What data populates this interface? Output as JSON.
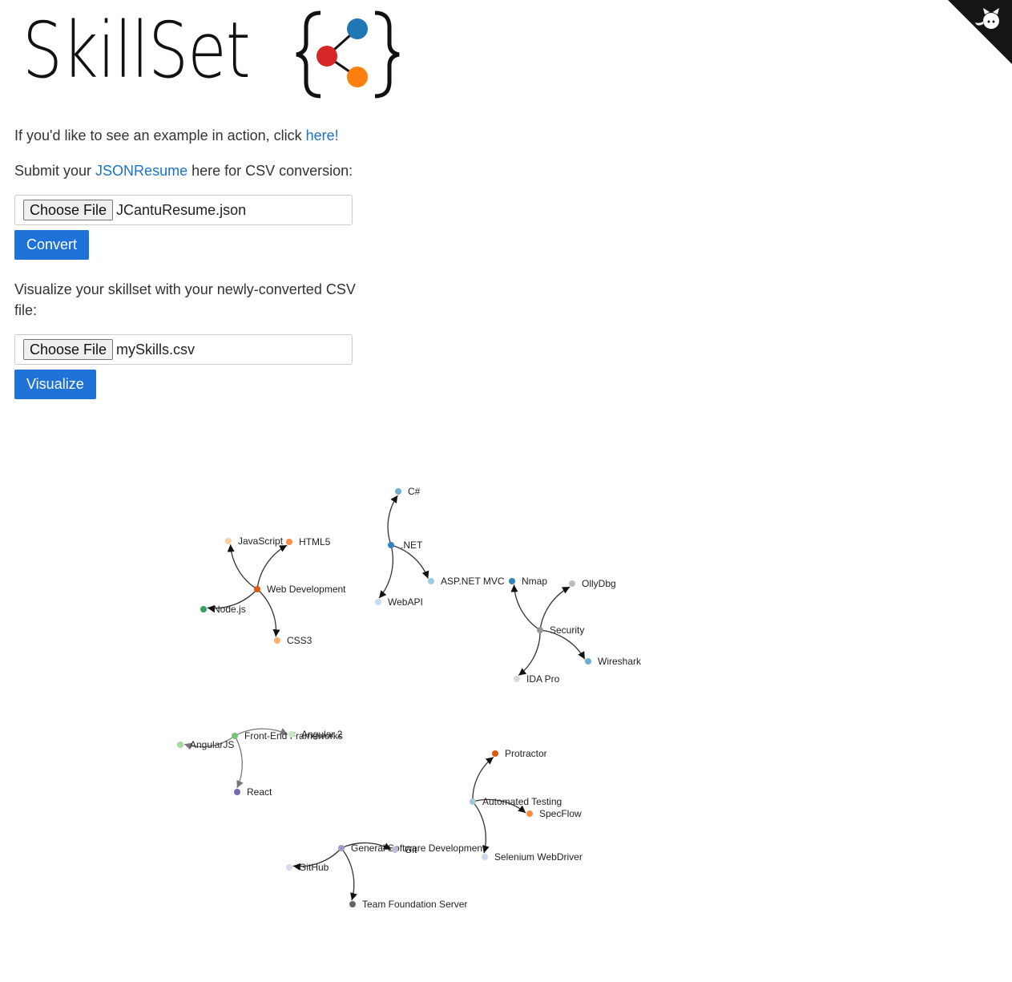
{
  "logo": {
    "text": "SkillSet",
    "dot_colors": [
      "#1f77b4",
      "#d62728",
      "#ff7f0e"
    ]
  },
  "intro": {
    "prefix": "If you'd like to see an example in action, click ",
    "link": "here!"
  },
  "submit": {
    "prefix": "Submit your ",
    "link": "JSONResume",
    "suffix": " here for CSV conversion:"
  },
  "resume_input": {
    "button_label": "Choose File",
    "file_name": "JCantuResume.json"
  },
  "convert_button": "Convert",
  "visualize_text": "Visualize your skillset with your newly-converted CSV file:",
  "csv_input": {
    "button_label": "Choose File",
    "file_name": "mySkills.csv"
  },
  "visualize_button": "Visualize",
  "graph": {
    "nodes": [
      {
        "id": "webdev",
        "label": "Web Development",
        "color": "#e6550d"
      },
      {
        "id": "js",
        "label": "JavaScript",
        "color": "#fdd0a2"
      },
      {
        "id": "html5",
        "label": "HTML5",
        "color": "#fd8d3c"
      },
      {
        "id": "node",
        "label": "Node.js",
        "color": "#31a354"
      },
      {
        "id": "css3",
        "label": "CSS3",
        "color": "#fdae6b"
      },
      {
        "id": "net",
        "label": ".NET",
        "color": "#3182bd"
      },
      {
        "id": "csharp",
        "label": "C#",
        "color": "#6baed6"
      },
      {
        "id": "aspnet",
        "label": "ASP.NET MVC",
        "color": "#9ecae1"
      },
      {
        "id": "webapi",
        "label": "WebAPI",
        "color": "#c6dbef"
      },
      {
        "id": "security",
        "label": "Security",
        "color": "#969696"
      },
      {
        "id": "nmap",
        "label": "Nmap",
        "color": "#3182bd"
      },
      {
        "id": "ollydbg",
        "label": "OllyDbg",
        "color": "#bdbdbd"
      },
      {
        "id": "wireshark",
        "label": "Wireshark",
        "color": "#6baed6"
      },
      {
        "id": "idapro",
        "label": "IDA Pro",
        "color": "#d9d9d9"
      },
      {
        "id": "frontend",
        "label": "Front-End Frameworks",
        "color": "#74c476"
      },
      {
        "id": "angularjs",
        "label": "AngularJS",
        "color": "#a1d99b"
      },
      {
        "id": "angular2",
        "label": "Angular 2",
        "color": "#c7e9c0"
      },
      {
        "id": "react",
        "label": "React",
        "color": "#756bb1"
      },
      {
        "id": "autotest",
        "label": "Automated Testing",
        "color": "#9ecae1"
      },
      {
        "id": "protractor",
        "label": "Protractor",
        "color": "#e6550d"
      },
      {
        "id": "specflow",
        "label": "SpecFlow",
        "color": "#fd8d3c"
      },
      {
        "id": "selenium",
        "label": "Selenium WebDriver",
        "color": "#c6dbef"
      },
      {
        "id": "gensw",
        "label": "General Software Development",
        "color": "#9e9ac8"
      },
      {
        "id": "git",
        "label": "Git",
        "color": "#bcbddc"
      },
      {
        "id": "github",
        "label": "GitHub",
        "color": "#dadaeb"
      },
      {
        "id": "tfs",
        "label": "Team Foundation Server",
        "color": "#636363"
      }
    ],
    "links": [
      {
        "source": "webdev",
        "target": "js",
        "color": "#333333"
      },
      {
        "source": "webdev",
        "target": "html5",
        "color": "#333333"
      },
      {
        "source": "webdev",
        "target": "node",
        "color": "#333333"
      },
      {
        "source": "webdev",
        "target": "css3",
        "color": "#333333"
      },
      {
        "source": "net",
        "target": "csharp",
        "color": "#333333"
      },
      {
        "source": "net",
        "target": "aspnet",
        "color": "#333333"
      },
      {
        "source": "net",
        "target": "webapi",
        "color": "#333333"
      },
      {
        "source": "security",
        "target": "nmap",
        "color": "#333333"
      },
      {
        "source": "security",
        "target": "ollydbg",
        "color": "#333333"
      },
      {
        "source": "security",
        "target": "wireshark",
        "color": "#333333"
      },
      {
        "source": "security",
        "target": "idapro",
        "color": "#333333"
      },
      {
        "source": "frontend",
        "target": "angularjs",
        "color": "#777777"
      },
      {
        "source": "frontend",
        "target": "angular2",
        "color": "#777777"
      },
      {
        "source": "frontend",
        "target": "react",
        "color": "#777777"
      },
      {
        "source": "autotest",
        "target": "protractor",
        "color": "#333333"
      },
      {
        "source": "autotest",
        "target": "specflow",
        "color": "#333333"
      },
      {
        "source": "autotest",
        "target": "selenium",
        "color": "#333333"
      },
      {
        "source": "gensw",
        "target": "git",
        "color": "#333333"
      },
      {
        "source": "gensw",
        "target": "github",
        "color": "#333333"
      },
      {
        "source": "gensw",
        "target": "tfs",
        "color": "#333333"
      }
    ]
  }
}
